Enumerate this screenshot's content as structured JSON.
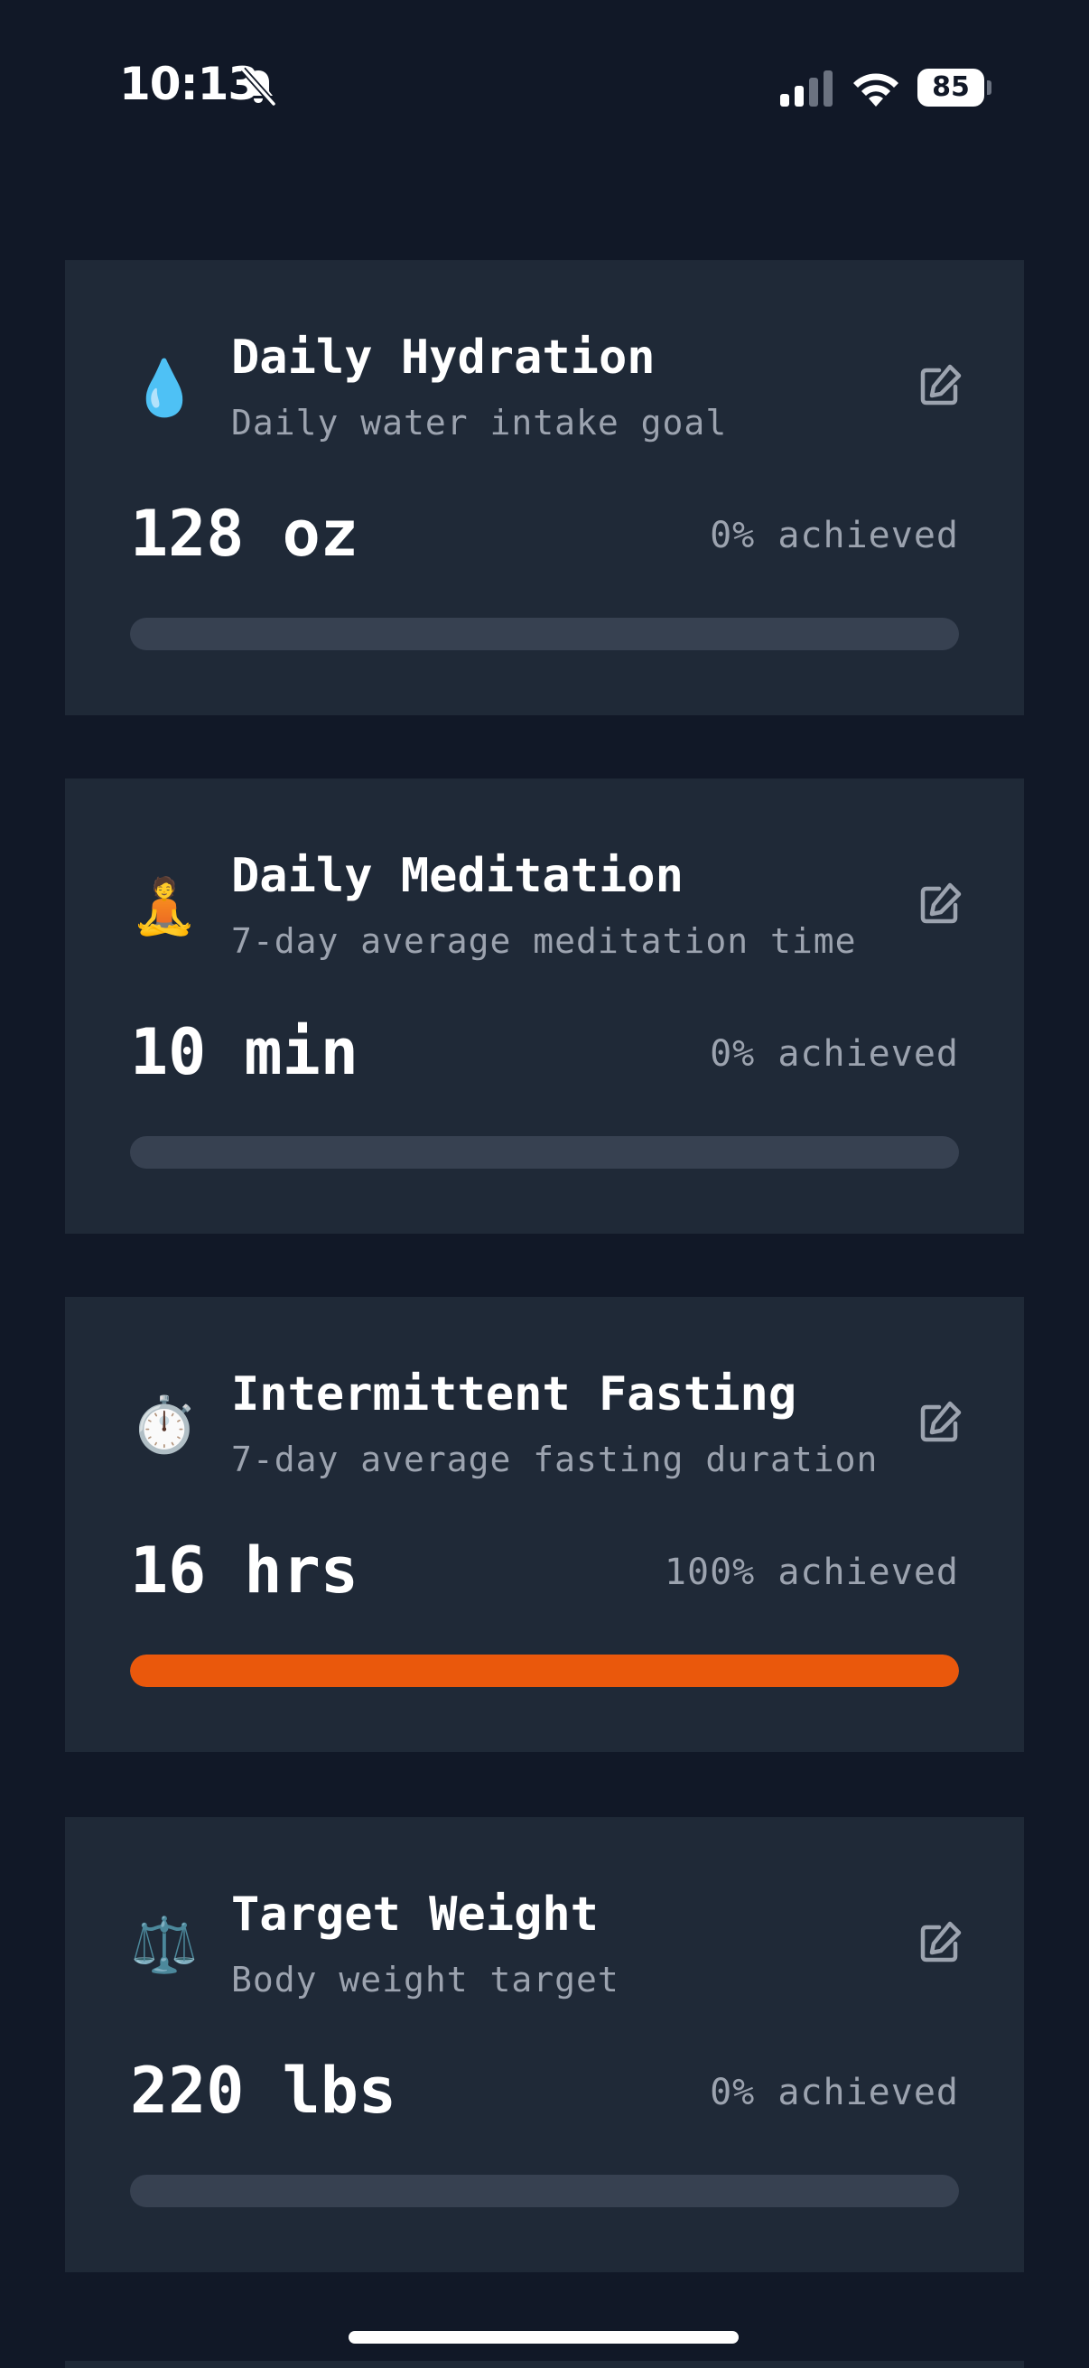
{
  "status_bar": {
    "time": "10:13",
    "battery": "85"
  },
  "cards": [
    {
      "emoji": "💧",
      "icon_name": "water-drop-icon",
      "title": "Daily Hydration",
      "subtitle": "Daily water intake goal",
      "value": "128 oz",
      "achieved": "0% achieved",
      "progress": 0
    },
    {
      "emoji": "🧘",
      "icon_name": "meditation-icon",
      "title": "Daily Meditation",
      "subtitle": "7-day average meditation time",
      "value": "10 min",
      "achieved": "0% achieved",
      "progress": 0
    },
    {
      "emoji": "⏱️",
      "icon_name": "stopwatch-icon",
      "title": "Intermittent Fasting",
      "subtitle": "7-day average fasting duration",
      "value": "16 hrs",
      "achieved": "100% achieved",
      "progress": 100
    },
    {
      "emoji": "⚖️",
      "icon_name": "scale-icon",
      "title": "Target Weight",
      "subtitle": "Body weight target",
      "value": "220 lbs",
      "achieved": "0% achieved",
      "progress": 0
    }
  ],
  "colors": {
    "background": "#111827",
    "card": "#1f2937",
    "accent": "#ea580c",
    "track": "#374151",
    "muted_text": "#9ca3af"
  }
}
